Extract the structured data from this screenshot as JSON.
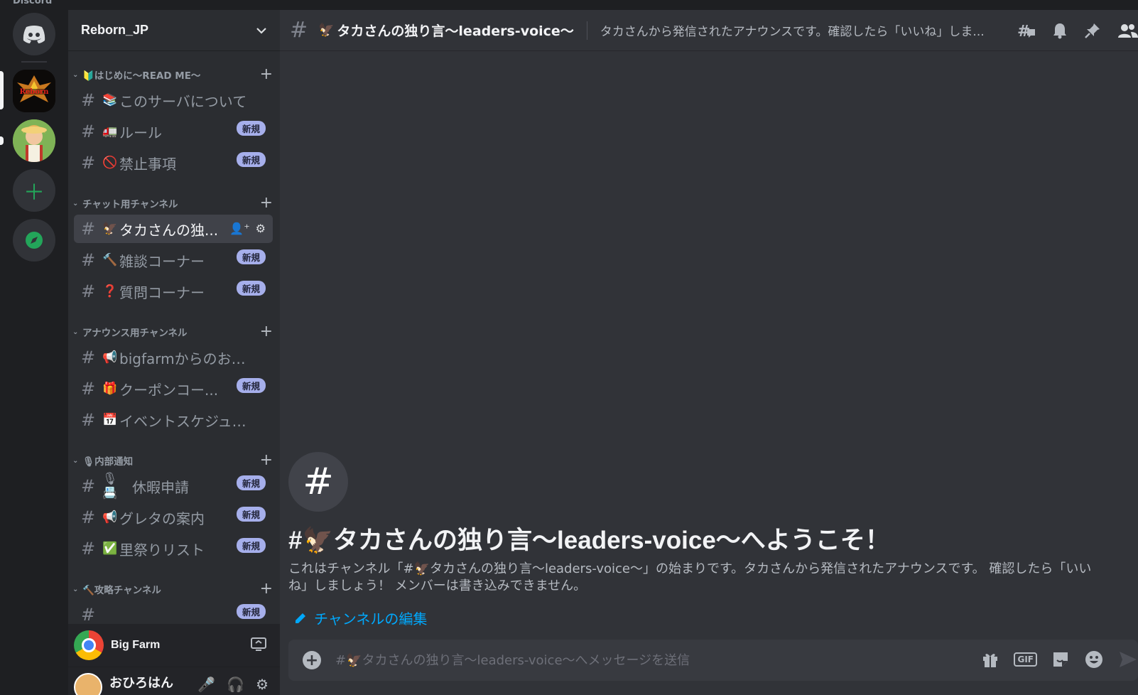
{
  "app": {
    "title": "Discord"
  },
  "servers": [
    {
      "name": "Discord ホーム",
      "icon": "discord-logo-icon"
    },
    {
      "name": "Reborn",
      "icon": "reborn-server-icon"
    },
    {
      "name": "Big Farm",
      "icon": "farm-server-icon"
    }
  ],
  "rail": {
    "add_icon": "plus-icon",
    "explore_icon": "compass-icon"
  },
  "guild": {
    "name": "Reborn_JP"
  },
  "categories": [
    {
      "label": "🔰はじめに〜READ ME〜",
      "channels": [
        {
          "emoji": "📚",
          "name": "このサーバについて",
          "badge": ""
        },
        {
          "emoji": "🚛",
          "name": "ルール",
          "badge": "新規"
        },
        {
          "emoji": "🚫",
          "name": "禁止事項",
          "badge": "新規"
        }
      ]
    },
    {
      "label": "チャット用チャンネル",
      "channels": [
        {
          "emoji": "🦅",
          "name": "タカさんの独...",
          "badge": ""
        },
        {
          "emoji": "🔨",
          "name": "雑談コーナー",
          "badge": "新規"
        },
        {
          "emoji": "❓",
          "name": "質問コーナー",
          "badge": "新規"
        }
      ]
    },
    {
      "label": "アナウンス用チャンネル",
      "channels": [
        {
          "emoji": "📢",
          "name": "bigfarmからのおし...",
          "badge": ""
        },
        {
          "emoji": "🎁",
          "name": "クーポンコー...",
          "badge": "新規"
        },
        {
          "emoji": "📅",
          "name": "イベントスケジュール",
          "badge": ""
        }
      ]
    },
    {
      "label": "🎙内部通知",
      "channels": [
        {
          "emoji": "🎙📇",
          "name": "休暇申請",
          "badge": "新規"
        },
        {
          "emoji": "📢",
          "name": "グレタの案内",
          "badge": "新規"
        },
        {
          "emoji": "✅",
          "name": "里祭りリスト",
          "badge": "新規"
        }
      ]
    },
    {
      "label": "🔨攻略チャンネル",
      "channels": [
        {
          "emoji": "",
          "name": "",
          "badge": "新規"
        }
      ]
    }
  ],
  "activity": {
    "name": "Big Farm"
  },
  "user": {
    "name": "おひろはん"
  },
  "channel": {
    "hash": "#",
    "emoji": "🦅",
    "title": "タカさんの独り言〜leaders-voice〜",
    "topic": "タカさんから発信されたアナウンスです。確認したら「いいね」しま..."
  },
  "welcome": {
    "icon": "#",
    "title": "#🦅タカさんの独り言〜leaders-voice〜へようこそ！",
    "description": "これはチャンネル「#🦅タカさんの独り言〜leaders-voice〜」の始まりです。タカさんから発信されたアナウンスです。 確認したら「いいね」しましょう！ メンバーは書き込みできません。",
    "edit_label": "チャンネルの編集"
  },
  "composer": {
    "placeholder": "#🦅タカさんの独り言〜leaders-voice〜へメッセージを送信",
    "gif_label": "GIF"
  },
  "colors": {
    "accent": "#5865f2",
    "link": "#00a8fc",
    "online": "#23a55a"
  }
}
